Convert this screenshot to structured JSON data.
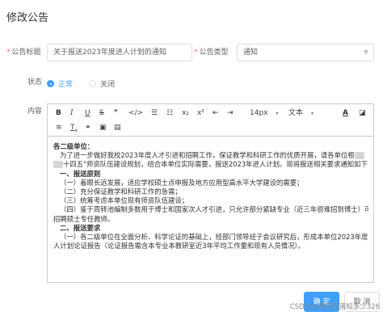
{
  "dialog": {
    "title": "修改公告"
  },
  "form": {
    "title_label": "公告标题",
    "title_value": "关于报送2023年度进人计划的通知",
    "type_label": "公告类型",
    "type_value": "通知",
    "status_label": "状态",
    "status_options": [
      "正常",
      "关闭"
    ],
    "status_selected": "正常",
    "content_label": "内容"
  },
  "toolbar": {
    "font_size": "14px",
    "font_family": "文本"
  },
  "editor": {
    "lines": [
      "各二级单位：",
      "为了进一步做好我校2023年度人才引进和招聘工作，保证教学和科研工作的优质开展，请各单位根",
      "十四五\"师资队伍建设规划，结合本单位实际需要，报送2023年进人计划。现将报送相关要求通知如下：",
      "一、报送原则",
      "（一）着眼长远发展，适应学校硕士点申报及地方应用型高水平大学建设的需要；",
      "（二）充分保证教学和科研工作的急需；",
      "（三）统筹考虑本单位现有师资队伍建设；",
      "（四）鉴于周转池编制多数用于博士和国家次人才引进，只允许部分紧缺专业（近三年很难招到博士）可以",
      "招聘硕士专任教师。",
      "二、报送要求",
      "（一）各二级单位在全面分析、科学论证的基础上，经部门领导班子会议研究后，形成本单位2023年度进",
      "人计划论证报告（论证报告需含本专业本教研室近3年平均工作量和现有人员情况）。"
    ]
  },
  "footer": {
    "confirm_label": "确 定",
    "cancel_label": "取 消",
    "watermark": "CSDN @梦里花落知多少326"
  },
  "colors": {
    "primary": "#409eff",
    "required": "#f56c6c"
  }
}
